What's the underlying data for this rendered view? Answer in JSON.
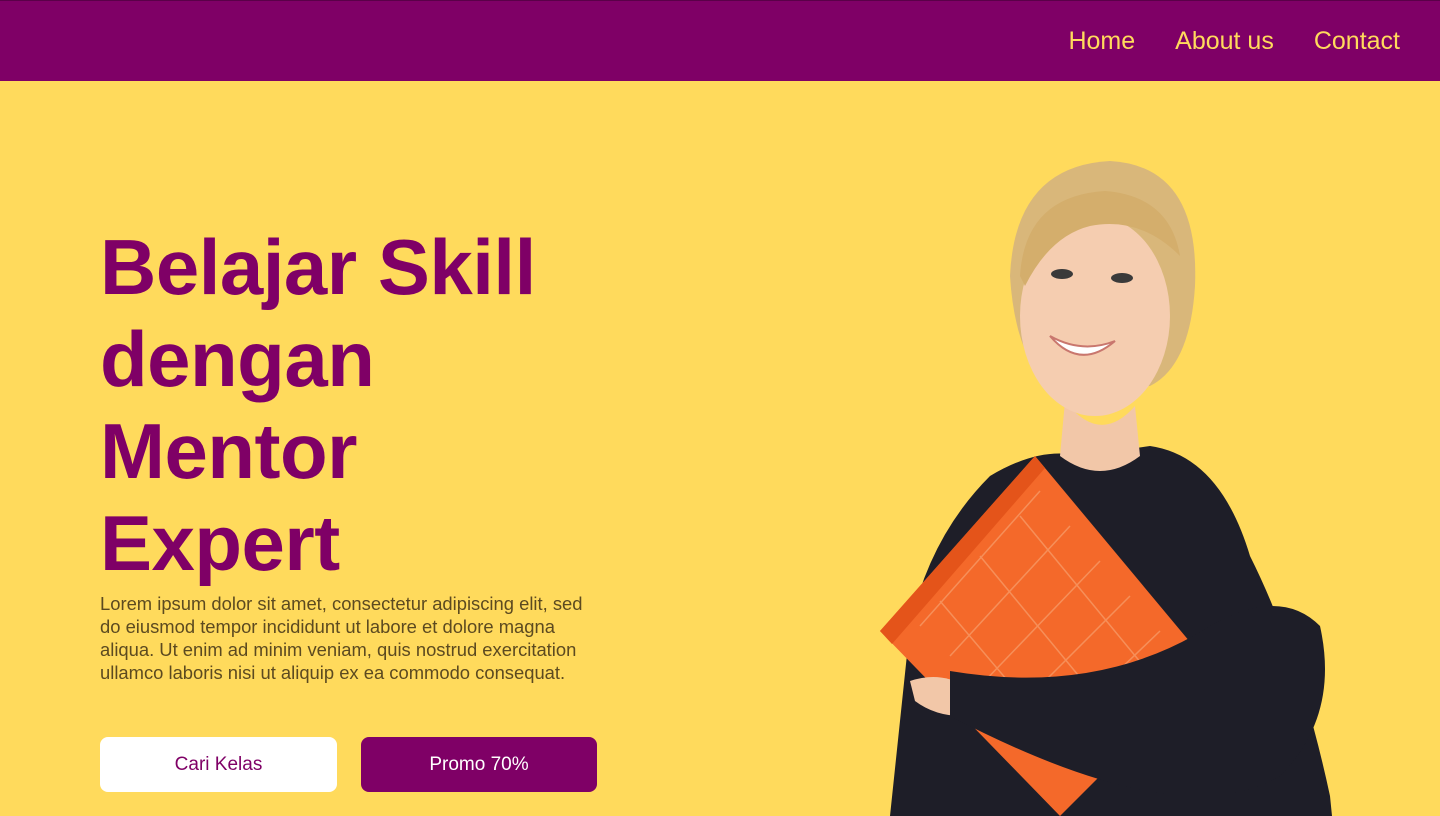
{
  "nav": {
    "items": [
      {
        "label": "Home"
      },
      {
        "label": "About us"
      },
      {
        "label": "Contact"
      }
    ]
  },
  "hero": {
    "title_lines": [
      "Belajar Skill",
      "dengan",
      "Mentor",
      "Expert"
    ],
    "description": "Lorem ipsum dolor sit amet, consectetur adipiscing elit, sed do eiusmod tempor incididunt ut labore et dolore magna aliqua. Ut enim ad minim veniam, quis nostrud exercitation ullamco laboris nisi ut aliquip ex ea commodo consequat.",
    "buttons": {
      "primary": "Cari Kelas",
      "secondary": "Promo 70%"
    }
  },
  "colors": {
    "brand": "#7F0066",
    "background": "#FFDA5C",
    "accent_text": "#FFDA5C",
    "book": "#F4692A",
    "sweater": "#1E1E28"
  }
}
